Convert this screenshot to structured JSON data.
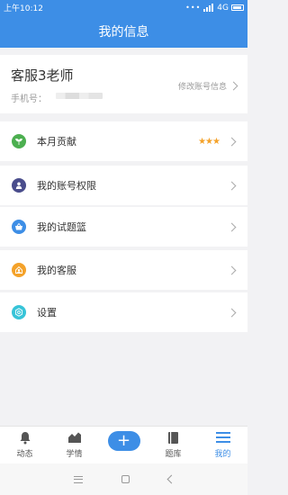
{
  "status_bar": {
    "time": "上午10:12",
    "network": "4G"
  },
  "header": {
    "title": "我的信息"
  },
  "profile": {
    "name": "客服3老师",
    "phone_label": "手机号：",
    "edit_label": "修改账号信息"
  },
  "menu": [
    {
      "label": "本月贡献",
      "icon": "sprout-icon",
      "color": "#4caf50",
      "stars": "★★★"
    },
    {
      "label": "我的账号权限",
      "icon": "user-icon",
      "color": "#4a4d8c"
    },
    {
      "label": "我的试题篮",
      "icon": "basket-icon",
      "color": "#3d8ee6"
    },
    {
      "label": "我的客服",
      "icon": "service-icon",
      "color": "#f4a22a"
    },
    {
      "label": "设置",
      "icon": "settings-icon",
      "color": "#37c4d8"
    }
  ],
  "tabs": [
    {
      "label": "动态",
      "icon": "bell-icon"
    },
    {
      "label": "学情",
      "icon": "chart-icon"
    },
    {
      "label": "",
      "icon": "plus-icon"
    },
    {
      "label": "题库",
      "icon": "book-icon"
    },
    {
      "label": "我的",
      "icon": "menu-lines-icon",
      "active": true
    }
  ],
  "colors": {
    "accent": "#3d8ee6",
    "star": "#f4a22a",
    "background": "#f2f2f4"
  }
}
